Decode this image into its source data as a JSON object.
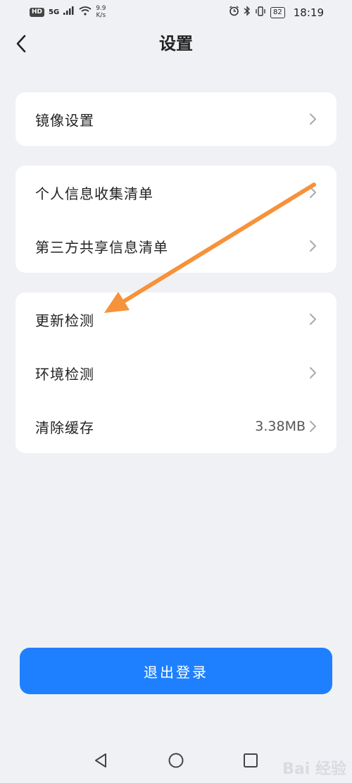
{
  "status_bar": {
    "hd": "HD",
    "signal": "5G",
    "speed_value": "9.9",
    "speed_unit": "K/s",
    "battery": "82",
    "time": "18:19"
  },
  "header": {
    "title": "设置"
  },
  "sections": [
    {
      "items": [
        {
          "label": "镜像设置"
        }
      ]
    },
    {
      "items": [
        {
          "label": "个人信息收集清单"
        },
        {
          "label": "第三方共享信息清单"
        }
      ]
    },
    {
      "items": [
        {
          "label": "更新检测"
        },
        {
          "label": "环境检测"
        },
        {
          "label": "清除缓存",
          "value": "3.38MB"
        }
      ]
    }
  ],
  "logout_label": "退出登录",
  "annotation": {
    "color": "#f6923a"
  },
  "colors": {
    "accent": "#1e80ff",
    "background": "#f0f1f5"
  },
  "watermark": "Bai 经验"
}
